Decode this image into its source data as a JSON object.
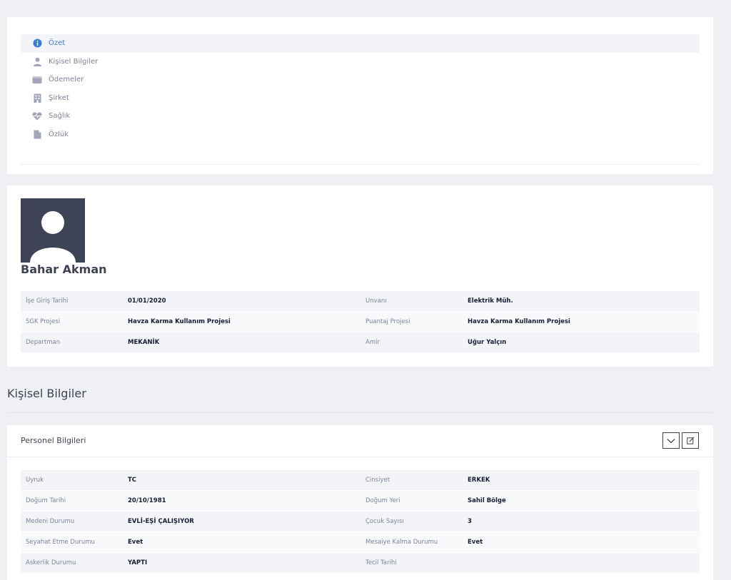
{
  "nav": {
    "items": [
      {
        "label": "Özet",
        "icon": "info-icon",
        "active": true
      },
      {
        "label": "Kişisel Bilgiler",
        "icon": "user-icon",
        "active": false
      },
      {
        "label": "Ödemeler",
        "icon": "wallet-icon",
        "active": false
      },
      {
        "label": "Şirket",
        "icon": "building-icon",
        "active": false
      },
      {
        "label": "Sağlık",
        "icon": "heartbeat-icon",
        "active": false
      },
      {
        "label": "Özlük",
        "icon": "document-icon",
        "active": false
      }
    ]
  },
  "profile": {
    "name": "Bahar Akman",
    "rows": [
      {
        "label1": "İşe Giriş Tarihi",
        "value1": "01/01/2020",
        "label2": "Unvanı",
        "value2": "Elektrik Müh."
      },
      {
        "label1": "SGK Projesi",
        "value1": "Havza Karma Kullanım Projesi",
        "label2": "Puantaj Projesi",
        "value2": "Havza Karma Kullanım Projesi"
      },
      {
        "label1": "Departman",
        "value1": "MEKANİK",
        "label2": "Amir",
        "value2": "Uğur Yalçın"
      }
    ]
  },
  "section": {
    "title": "Kişisel Bilgiler"
  },
  "personel": {
    "title": "Personel Bilgileri",
    "rows": [
      {
        "label1": "Uyruk",
        "value1": "TC",
        "label2": "Cinsiyet",
        "value2": "ERKEK"
      },
      {
        "label1": "Doğum Tarihi",
        "value1": "20/10/1981",
        "label2": "Doğum Yeri",
        "value2": "Sahil Bölge"
      },
      {
        "label1": "Medeni Durumu",
        "value1": "EVLİ-EŞİ ÇALIŞIYOR",
        "label2": "Çocuk Sayısı",
        "value2": "3"
      },
      {
        "label1": "Seyahat Etme Durumu",
        "value1": "Evet",
        "label2": "Mesaiye Kalma Durumu",
        "value2": "Evet"
      },
      {
        "label1": "Askerlik Durumu",
        "value1": "YAPTI",
        "label2": "Tecil Tarihi",
        "value2": ""
      }
    ]
  },
  "colors": {
    "accent": "#3b7ddd",
    "icon_gray": "#a1a5b7",
    "avatar_bg": "#3f4356"
  }
}
